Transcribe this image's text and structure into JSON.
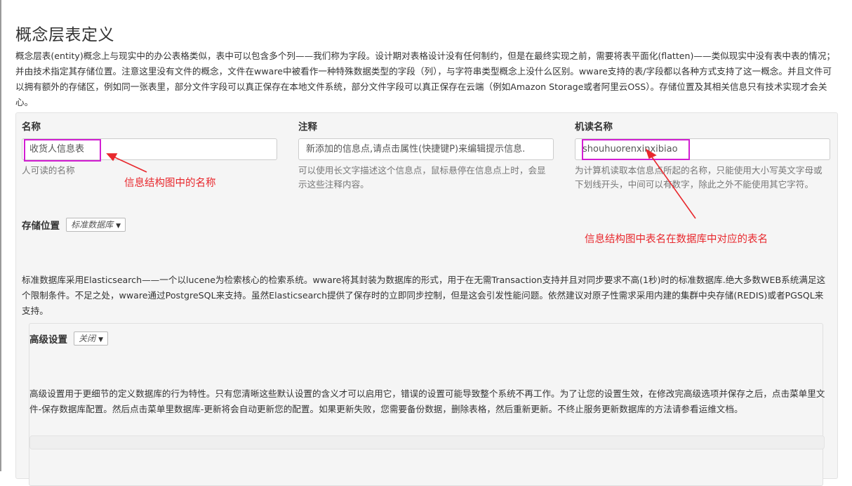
{
  "page": {
    "title": "概念层表定义",
    "intro": "概念层表(entity)概念上与现实中的办公表格类似，表中可以包含多个列——我们称为字段。设计期对表格设计没有任何制约，但是在最终实现之前，需要将表平面化(flatten)——类似现实中没有表中表的情况；并由技术指定其存储位置。注意这里没有文件的概念，文件在wware中被看作一种特殊数据类型的字段（列），与字符串类型概念上没什么区别。wware支持的表/字段都以各种方式支持了这一概念。并且文件可以拥有额外的存储区，例如同一张表里，部分文件字段可以真正保存在本地文件系统，部分文件字段可以真正保存在云端（例如Amazon Storage或者阿里云OSS）。存储位置及其相关信息只有技术实现才会关心。"
  },
  "fields": {
    "name": {
      "label": "名称",
      "value": "收货人信息表",
      "help": "人可读的名称"
    },
    "comment": {
      "label": "注释",
      "value": "新添加的信息点,请点击属性(快捷键P)来编辑提示信息.",
      "help": "可以使用长文字描述这个信息点，鼠标悬停在信息点上时，会显示这些注释内容。"
    },
    "code_name": {
      "label": "机读名称",
      "value": "shouhuorenxinxibiao",
      "help": "为计算机读取本信息点所起的名称，只能使用大小写英文字母或下划线开头，中间可以有数字，除此之外不能使用其它字符。"
    }
  },
  "annotations": {
    "name_note": "信息结构图中的名称",
    "code_note": "信息结构图中表名在数据库中对应的表名",
    "color": "#e8282d",
    "highlight_color": "#d21ed2"
  },
  "storage": {
    "label": "存储位置",
    "selected": "标准数据库",
    "description": "标准数据库采用Elasticsearch——一个以lucene为检索核心的检索系统。wware将其封装为数据库的形式，用于在无需Transaction支持并且对同步要求不高(1秒)时的标准数据库.绝大多数WEB系统满足这个限制条件。不足之处，wware通过PostgreSQL来支持。虽然Elasticsearch提供了保存时的立即同步控制，但是这会引发性能问题。依然建议对原子性需求采用内建的集群中央存储(REDIS)或者PGSQL来支持。"
  },
  "advanced": {
    "label": "高级设置",
    "selected": "关闭",
    "description": "高级设置用于更细节的定义数据库的行为特性。只有您清晰这些默认设置的含义才可以启用它，错误的设置可能导致整个系统不再工作。为了让您的设置生效，在修改完高级选项并保存之后，点击菜单里文件-保存数据库配置。然后点击菜单里数据库-更新将会自动更新您的配置。如果更新失败，您需要备份数据，删除表格，然后重新更新。不终止服务更新数据库的方法请参看运维文档。"
  }
}
